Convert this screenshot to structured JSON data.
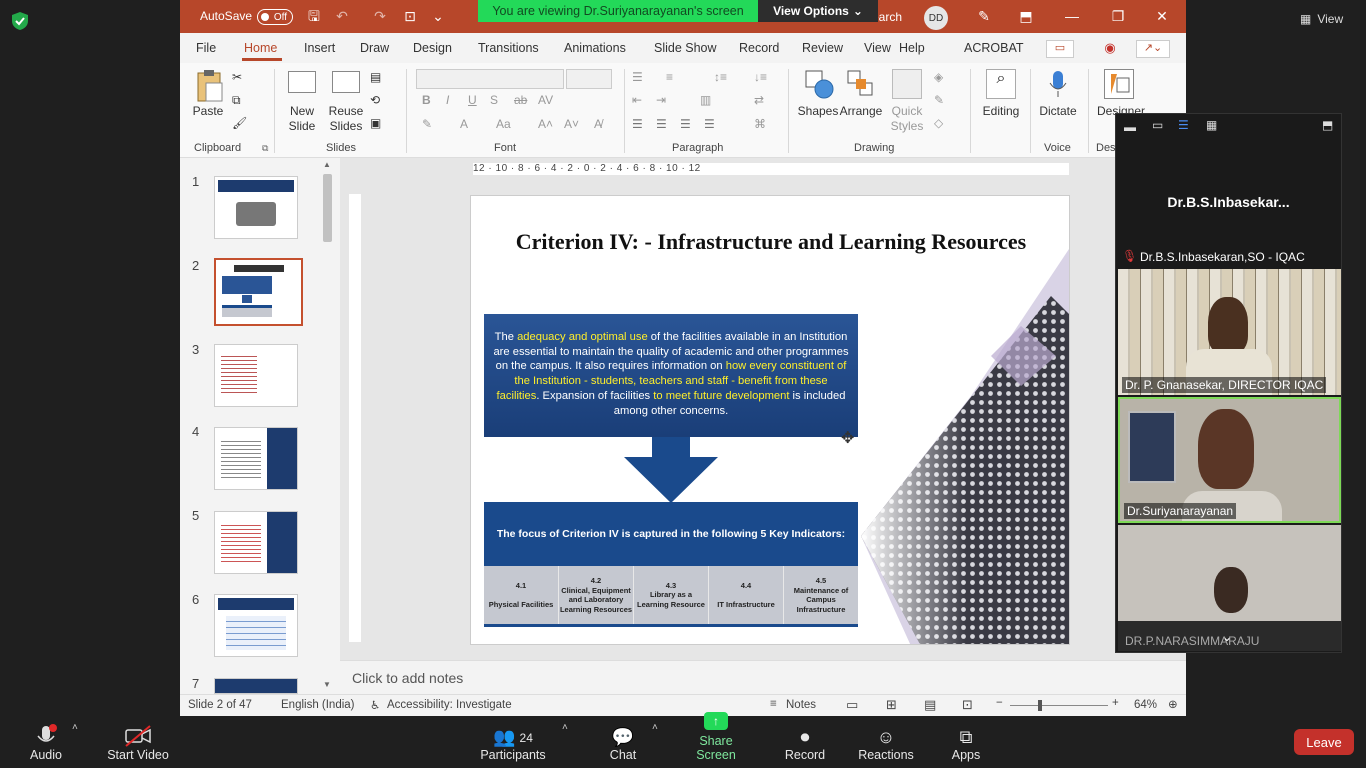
{
  "ppt": {
    "autosave": "AutoSave",
    "autosave_state": "Off",
    "search_word": "earch",
    "avatar": "DD",
    "menu": [
      "File",
      "Home",
      "Insert",
      "Draw",
      "Design",
      "Transitions",
      "Animations",
      "Slide Show",
      "Record",
      "Review",
      "View",
      "Help",
      "ACROBAT"
    ],
    "ribbon": {
      "paste": "Paste",
      "new_slide": "New Slide",
      "reuse_slides": "Reuse Slides",
      "shapes": "Shapes",
      "arrange": "Arrange",
      "quick_styles": "Quick Styles",
      "editing": "Editing",
      "dictate": "Dictate",
      "designer": "Designer",
      "groups": [
        "Clipboard",
        "Slides",
        "Font",
        "Paragraph",
        "Drawing",
        "Voice",
        "Des"
      ]
    },
    "thumbnails": [
      "1",
      "2",
      "3",
      "4",
      "5",
      "6",
      "7"
    ],
    "ruler_text": "12 · 10 · 8 · 6 · 4 · 2 · 0 · 2 · 4 · 6 · 8 · 10 · 12",
    "slide": {
      "title": "Criterion IV: - Infrastructure and Learning Resources",
      "p1": "The ",
      "p1_hl": "adequacy and optimal use",
      "p2": " of the facilities available in an Institution are essential to maintain the quality of academic and other programmes on the campus. It also requires information on ",
      "p2_hl": "how every constituent of the Institution - students, teachers and staff - benefit from these facilities",
      "p3": ". Expansion of facilities ",
      "p3_hl": "to meet future development",
      "p4": " is included among other concerns.",
      "focus": "The focus of Criterion IV is captured in the following 5 Key Indicators:",
      "indicators": [
        {
          "num": "4.1",
          "label": "Physical Facilities"
        },
        {
          "num": "4.2",
          "label": "Clinical, Equipment and Laboratory Learning Resources"
        },
        {
          "num": "4.3",
          "label": "Library as a Learning Resource"
        },
        {
          "num": "4.4",
          "label": "IT Infrastructure"
        },
        {
          "num": "4.5",
          "label": "Maintenance of Campus Infrastructure"
        }
      ]
    },
    "notes_placeholder": "Click to add notes",
    "status": {
      "slide_count": "Slide 2 of 47",
      "language": "English (India)",
      "accessibility": "Accessibility: Investigate",
      "notes": "Notes",
      "zoom": "64%"
    }
  },
  "zoom": {
    "banner": "You are viewing Dr.Suriyanarayanan's screen",
    "view_options": "View Options",
    "view": "View",
    "panel_host": "Dr.B.S.Inbasekar...",
    "participants": [
      {
        "name": "Dr.B.S.Inbasekaran,SO - IQAC"
      },
      {
        "name": "Dr. P. Gnanasekar, DIRECTOR IQAC"
      },
      {
        "name": "Dr.Suriyanarayanan"
      },
      {
        "name": "DR.P.NARASIMMARAJU"
      }
    ],
    "toolbar": {
      "audio": "Audio",
      "start_video": "Start Video",
      "participants": "Participants",
      "participants_count": "24",
      "chat": "Chat",
      "share_screen": "Share Screen",
      "record": "Record",
      "reactions": "Reactions",
      "apps": "Apps",
      "leave": "Leave"
    },
    "colors": {
      "accent": "#b7472a",
      "share": "#23d959",
      "leave": "#c4312b"
    }
  }
}
